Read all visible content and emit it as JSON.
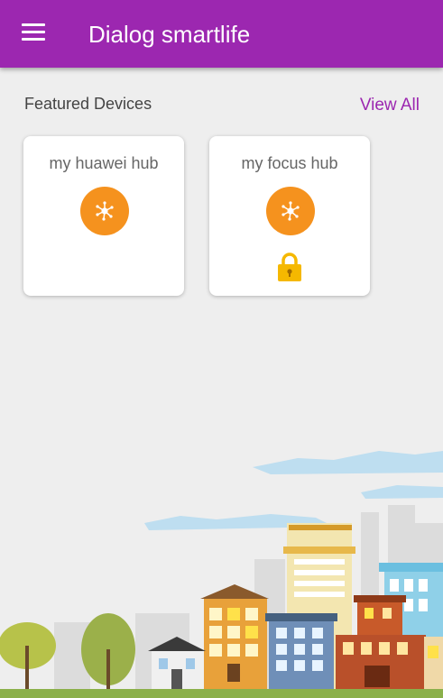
{
  "app": {
    "title": "Dialog smartlife"
  },
  "icons": {
    "menu": "hamburger-menu-icon",
    "hub": "hub-network-icon",
    "lock": "padlock-icon"
  },
  "colors": {
    "primary": "#9c27b0",
    "hub_icon": "#f5921e",
    "lock": "#f5b800",
    "background": "#eeeeee"
  },
  "featured": {
    "title": "Featured Devices",
    "view_all_label": "View All",
    "devices": [
      {
        "name": "my huawei hub",
        "locked": false
      },
      {
        "name": "my focus hub",
        "locked": true
      }
    ]
  }
}
